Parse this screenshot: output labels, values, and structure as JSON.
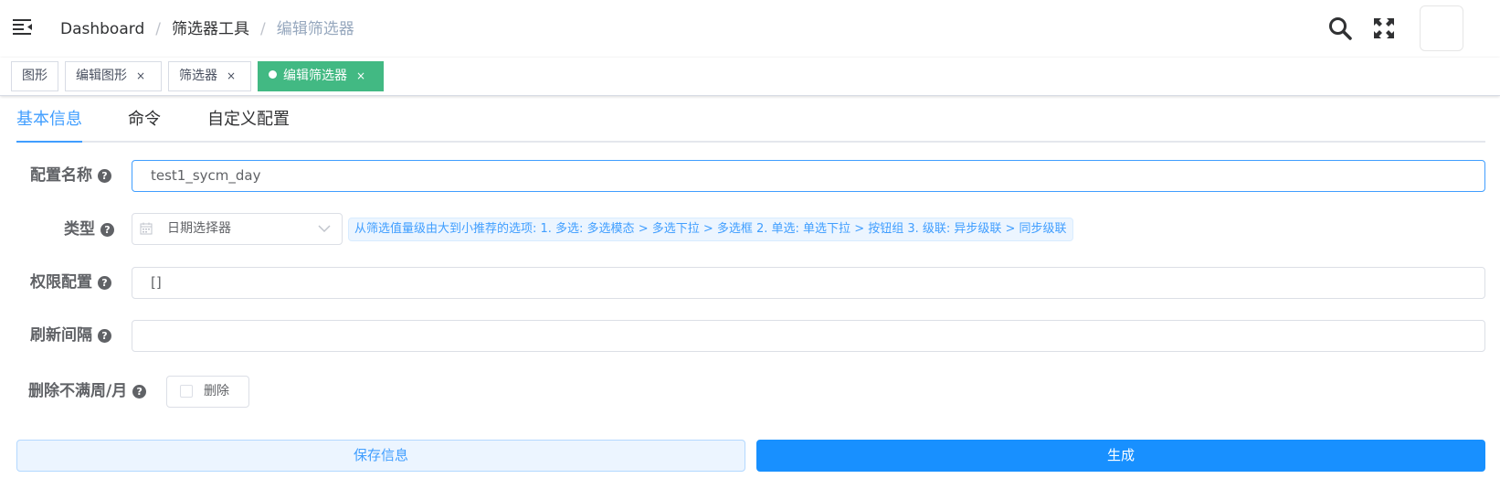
{
  "header": {
    "breadcrumb": [
      "Dashboard",
      "筛选器工具",
      "编辑筛选器"
    ],
    "separator": "/"
  },
  "tags": [
    {
      "label": "图形",
      "closable": false,
      "active": false
    },
    {
      "label": "编辑图形",
      "closable": true,
      "active": false
    },
    {
      "label": "筛选器",
      "closable": true,
      "active": false
    },
    {
      "label": "编辑筛选器",
      "closable": true,
      "active": true
    }
  ],
  "tag_close": "×",
  "tabs": [
    "基本信息",
    "命令",
    "自定义配置"
  ],
  "form": {
    "name_label": "配置名称",
    "name_value": "test1_sycm_day",
    "type_label": "类型",
    "type_value": "日期选择器",
    "type_hint": "从筛选值量级由大到小推荐的选项: 1. 多选: 多选模态 > 多选下拉 > 多选框 2. 单选: 单选下拉 > 按钮组 3. 级联: 异步级联 > 同步级联",
    "permission_label": "权限配置",
    "permission_value": "[]",
    "refresh_label": "刷新间隔",
    "refresh_value": "",
    "delete_label": "删除不满周/月",
    "delete_checkbox_label": "删除",
    "help_icon": "?"
  },
  "buttons": {
    "save": "保存信息",
    "generate": "生成"
  },
  "colors": {
    "primary": "#409eff",
    "active_tag": "#42b983",
    "generate_button": "#1890ff"
  }
}
